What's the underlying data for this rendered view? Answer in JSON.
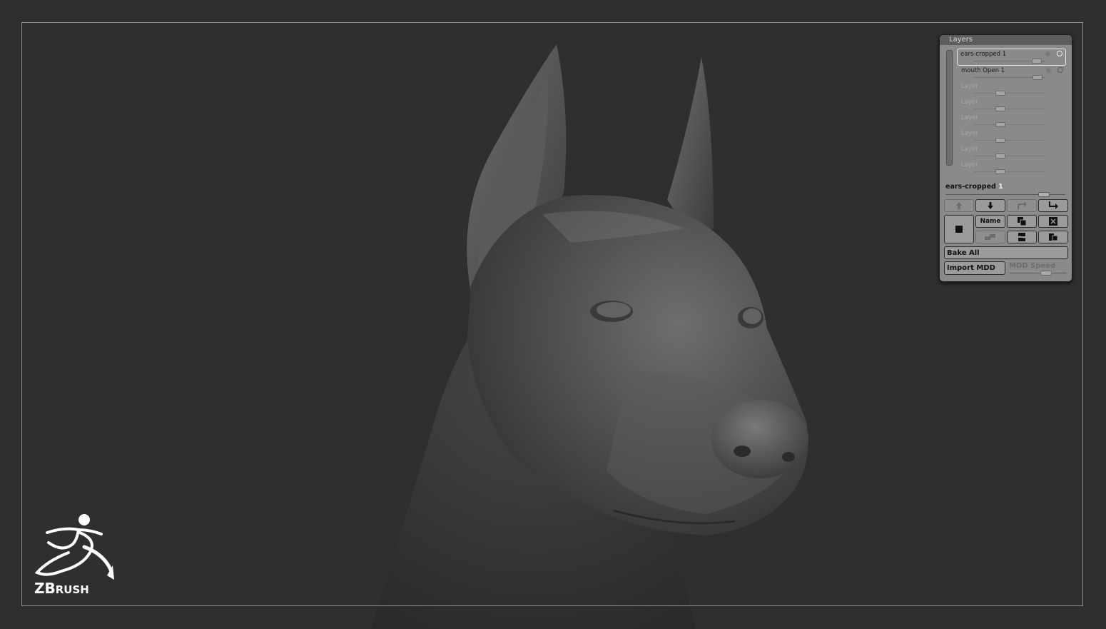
{
  "canvas": {
    "background": "#2f2f2f",
    "frame_color": "#8e8e8e",
    "model": "doberman-head-sculpt"
  },
  "layers_panel": {
    "title": "Layers",
    "layers": [
      {
        "label": "ears-cropped 1",
        "state": "selected",
        "intensity": 0.9
      },
      {
        "label": "mouth  Open 1",
        "state": "active",
        "intensity": 0.9
      },
      {
        "label": "Layer",
        "state": "empty",
        "intensity": 0.4
      },
      {
        "label": "Layer",
        "state": "empty",
        "intensity": 0.4
      },
      {
        "label": "Layer",
        "state": "empty",
        "intensity": 0.4
      },
      {
        "label": "Layer",
        "state": "empty",
        "intensity": 0.4
      },
      {
        "label": "Layer",
        "state": "empty",
        "intensity": 0.4
      },
      {
        "label": "Layer",
        "state": "empty",
        "intensity": 0.4
      }
    ],
    "selected_layer": {
      "name": "ears-cropped",
      "number": "1",
      "intensity": 0.83
    },
    "buttons": {
      "move_up_icon": "arrow-up-icon",
      "move_down_icon": "arrow-down-icon",
      "redo_icon": "redo-arrow-icon",
      "split_icon": "split-arrow-icon",
      "record_icon": "record-square-icon",
      "name_label": "Name",
      "duplicate_icon": "duplicate-icon",
      "delete_icon": "delete-x-icon",
      "merge_down_icon": "merge-down-icon",
      "invert_icon": "invert-icon",
      "copy_icon": "copy-layer-icon",
      "bake_all_label": "Bake All",
      "import_mdd_label": "Import MDD",
      "mdd_speed_label": "MDD Speed"
    }
  },
  "logo": {
    "brand_big": "ZB",
    "brand_small": "RUSH",
    "color": "#ffffff"
  }
}
